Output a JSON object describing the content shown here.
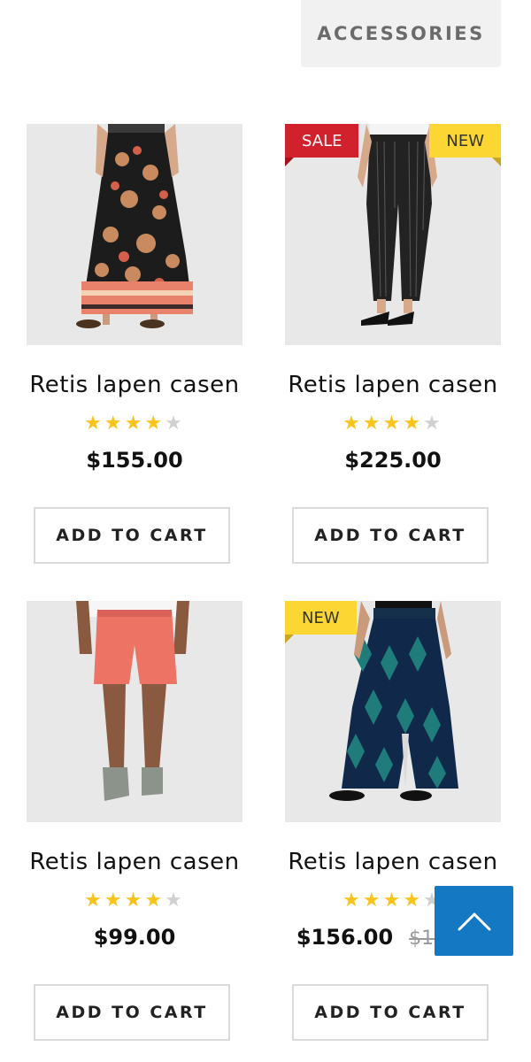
{
  "tabs": {
    "accessories_label": "ACCESSORIES"
  },
  "products": [
    {
      "title": "Retis lapen casen",
      "rating": 4,
      "price": "$155.00",
      "cta": "ADD TO CART"
    },
    {
      "title": "Retis lapen casen",
      "rating": 4,
      "price": "$225.00",
      "cta": "ADD TO CART",
      "badges": {
        "sale": "SALE",
        "new": "NEW"
      }
    },
    {
      "title": "Retis lapen casen",
      "rating": 4,
      "price": "$99.00",
      "cta": "ADD TO CART"
    },
    {
      "title": "Retis lapen casen",
      "rating": 4,
      "price": "$156.00",
      "old_price": "$167.00",
      "cta": "ADD TO CART",
      "badges": {
        "new": "NEW"
      }
    }
  ],
  "icons": {
    "scroll_top": "chevron-up-icon",
    "star": "star-icon"
  },
  "colors": {
    "sale": "#d0212c",
    "new": "#fcd733",
    "star": "#f8c31a",
    "scroll_top": "#1578c3"
  }
}
